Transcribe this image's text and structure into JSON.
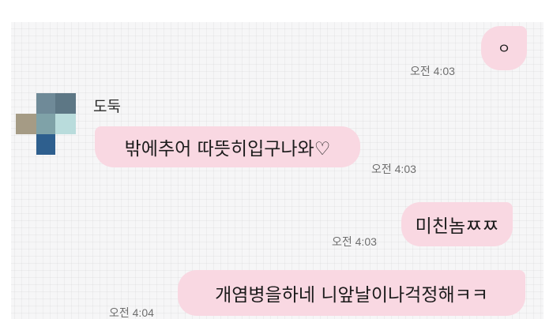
{
  "messages": [
    {
      "id": "m1",
      "direction": "outgoing",
      "text": "ㅇ",
      "time": "오전 4:03"
    },
    {
      "id": "m2",
      "direction": "incoming",
      "sender": "도둑",
      "text": "밖에추어 따뜻히입구나와♡",
      "time": "오전 4:03"
    },
    {
      "id": "m3",
      "direction": "outgoing",
      "text": "미친놈ㅉㅉ",
      "time": "오전 4:03"
    },
    {
      "id": "m4",
      "direction": "outgoing",
      "text": "개염병을하네 니앞날이나걱정해ㅋㅋ",
      "time": "오전 4:04"
    }
  ],
  "colors": {
    "bubble": "#f9d8e2",
    "background": "#f6f6f7",
    "time_text": "#6e6e6e"
  },
  "avatar_icon": "pixelated-profile-icon"
}
